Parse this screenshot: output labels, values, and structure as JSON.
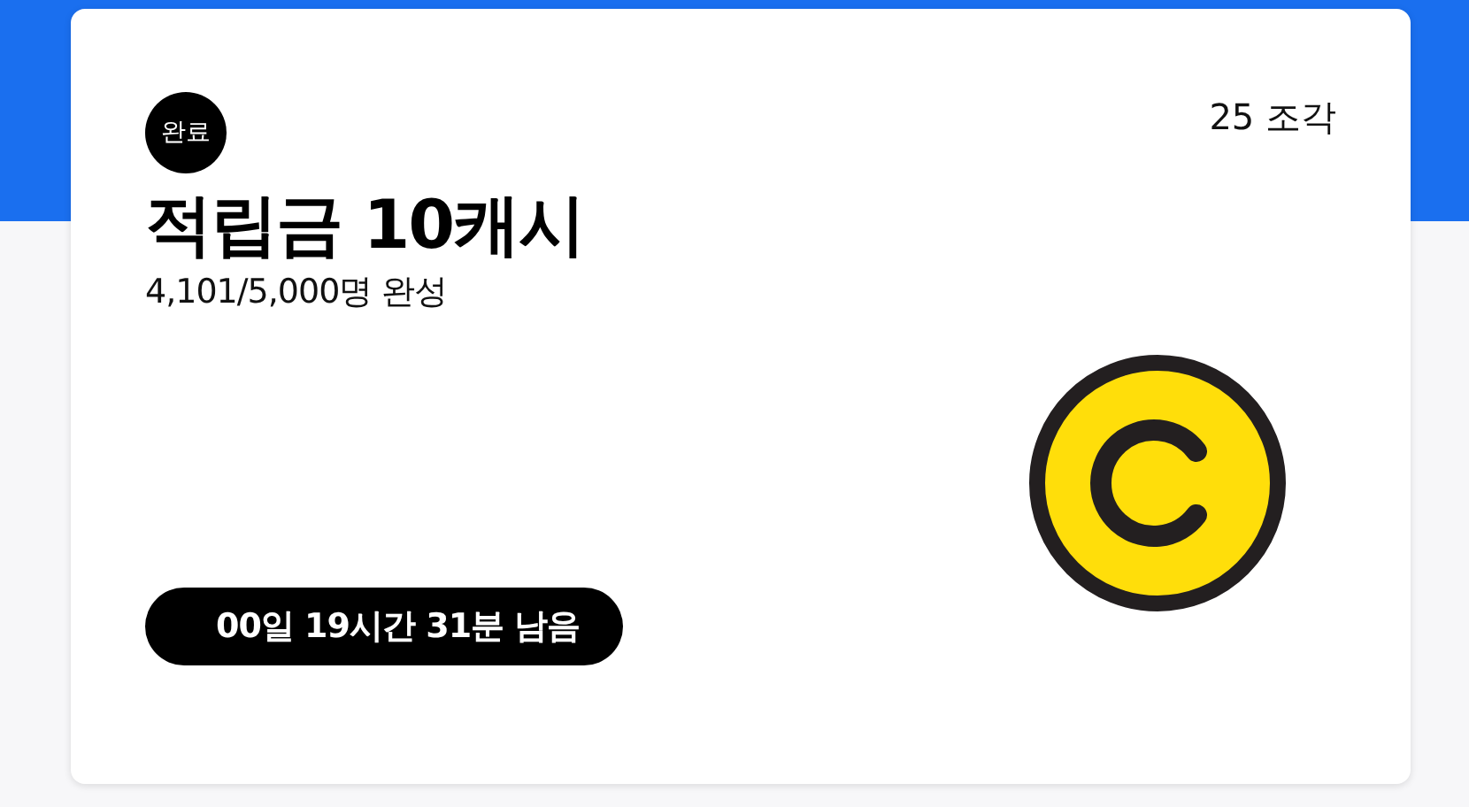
{
  "card": {
    "status": "완료",
    "pieces": "25 조각",
    "title": "적립금 10캐시",
    "progress": "4,101/5,000명 완성",
    "time_left": "00일 19시간 31분 남음"
  }
}
